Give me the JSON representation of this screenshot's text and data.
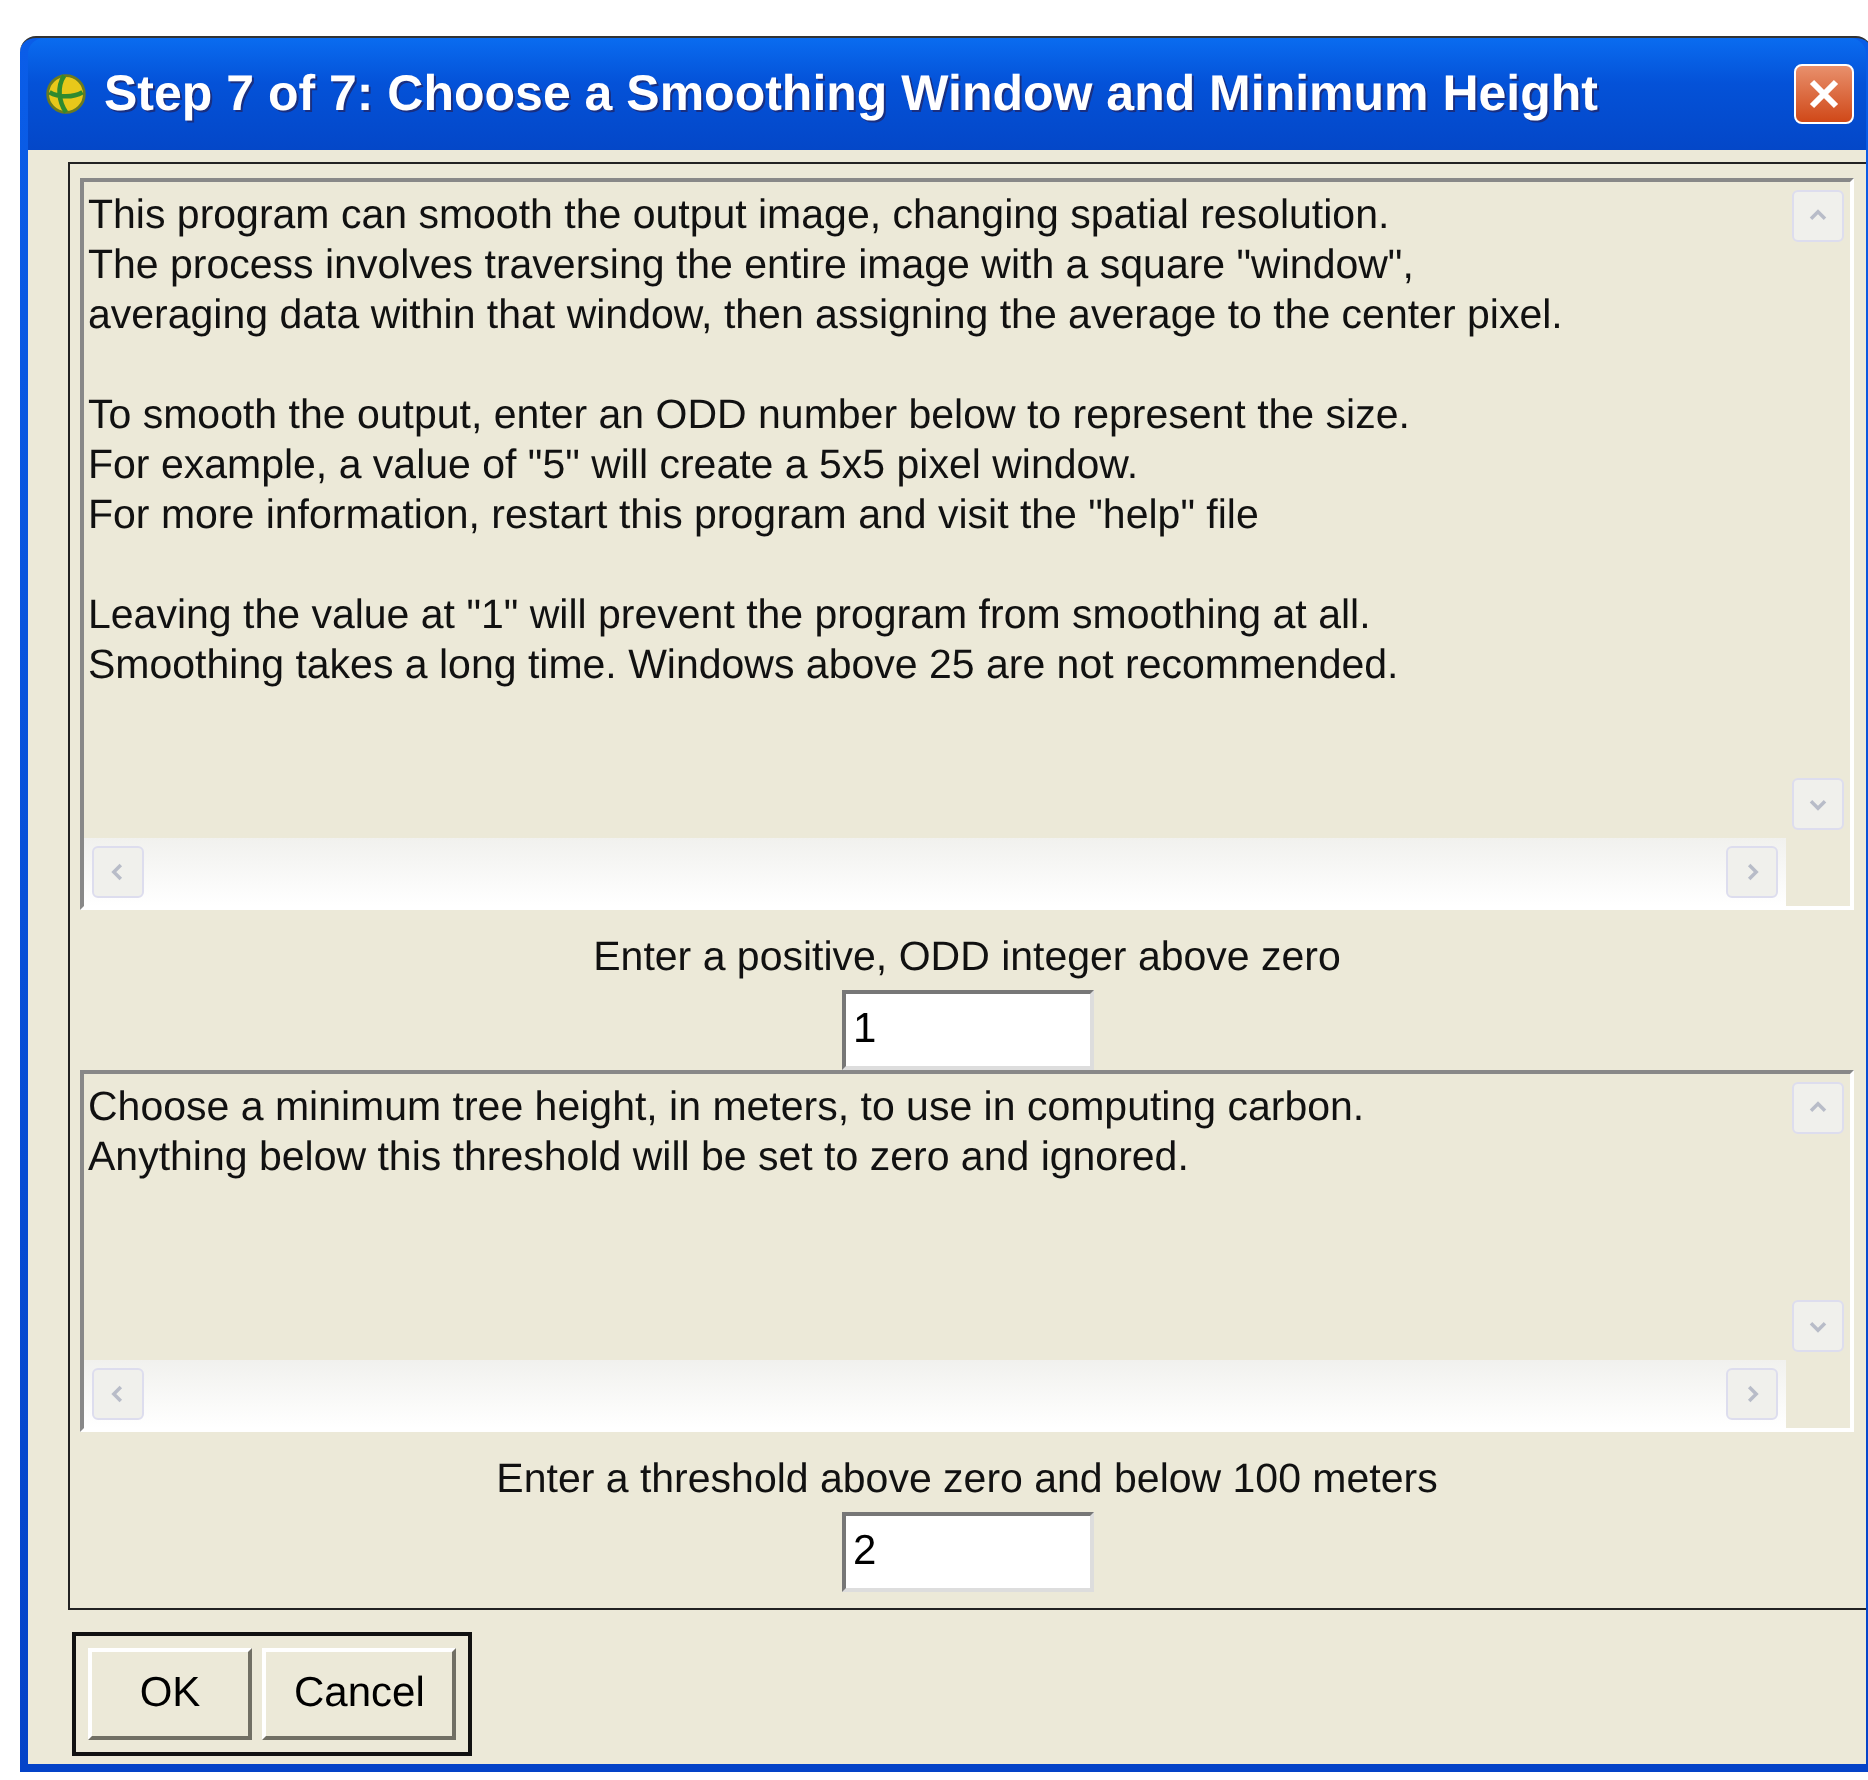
{
  "window": {
    "title": "Step 7 of 7: Choose a Smoothing Window and Minimum Height"
  },
  "sections": [
    {
      "message": [
        [
          "This program can smooth the output image, changing spatial resolution.",
          "The process involves traversing the entire image with a square \"window\",",
          "averaging data within that window, then assigning the average to the center pixel."
        ],
        [
          "To smooth the output, enter an ODD number below to represent the size.",
          "For example, a value of \"5\" will create a 5x5 pixel window.",
          "For more information, restart this program and visit the \"help\" file"
        ],
        [
          "Leaving the value at \"1\" will prevent the program from smoothing at all.",
          "Smoothing takes a long time. Windows above 25 are not recommended."
        ]
      ],
      "prompt": "Enter a positive, ODD integer above zero",
      "value": "1"
    },
    {
      "message": [
        [
          "Choose a minimum tree height, in meters, to use in computing carbon.",
          "Anything below this threshold will be set to zero and ignored."
        ]
      ],
      "prompt": "Enter a threshold above zero and below 100 meters",
      "value": "2"
    }
  ],
  "buttons": [
    "OK",
    "Cancel"
  ]
}
